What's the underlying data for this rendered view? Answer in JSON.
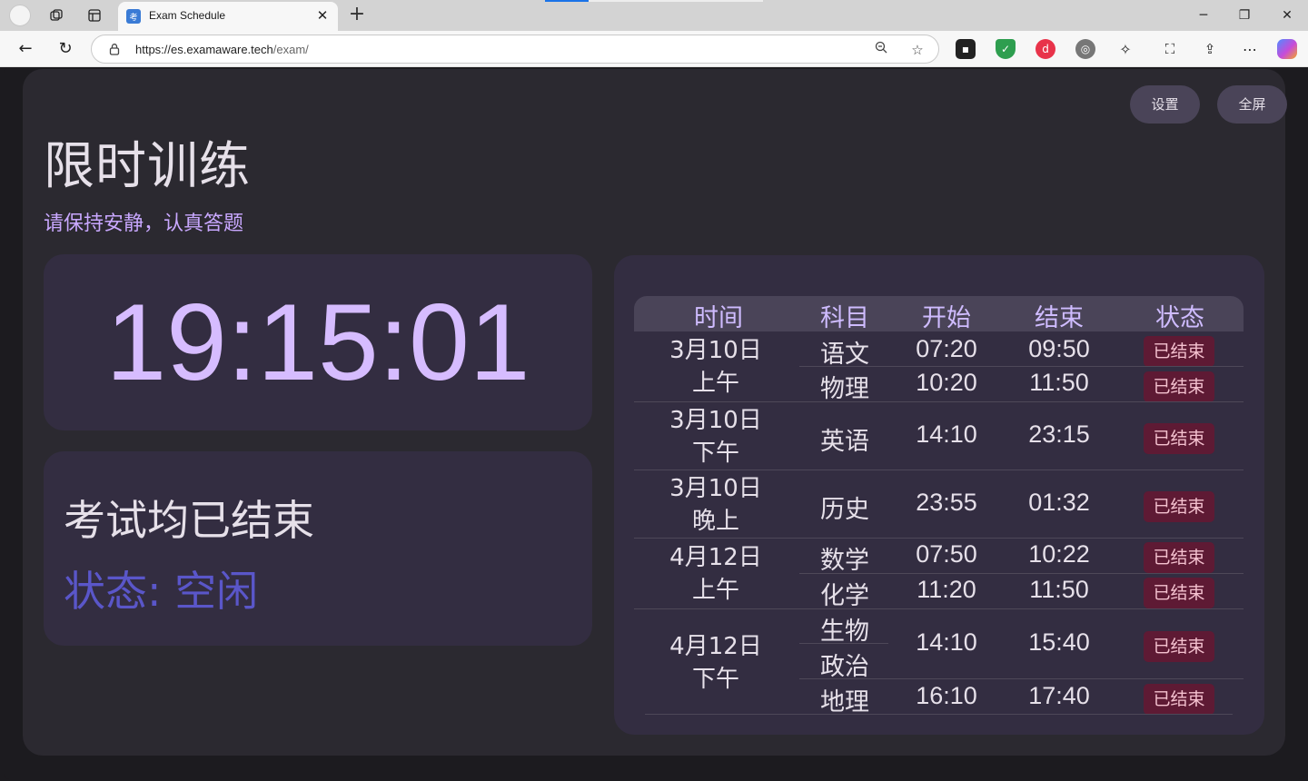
{
  "browser": {
    "tab_title": "Exam Schedule",
    "tab_favicon": "考",
    "url_host": "https://es.examaware.tech",
    "url_path": "/exam/"
  },
  "header": {
    "settings_label": "设置",
    "fullscreen_label": "全屏",
    "title": "限时训练",
    "subtitle": "请保持安静，认真答题"
  },
  "clock": {
    "time": "19:15:01"
  },
  "status": {
    "message": "考试均已结束",
    "state": "状态: 空闲"
  },
  "schedule": {
    "headers": [
      "时间",
      "科目",
      "开始",
      "结束",
      "状态"
    ],
    "groups": [
      {
        "date": "3月10日",
        "period": "上午"
      },
      {
        "date": "3月10日",
        "period": "下午"
      },
      {
        "date": "3月10日",
        "period": "晚上"
      },
      {
        "date": "4月12日",
        "period": "上午"
      },
      {
        "date": "4月12日",
        "period": "下午"
      }
    ],
    "rows": [
      {
        "subject": "语文",
        "start": "07:20",
        "end": "09:50",
        "status": "已结束"
      },
      {
        "subject": "物理",
        "start": "10:20",
        "end": "11:50",
        "status": "已结束"
      },
      {
        "subject": "英语",
        "start": "14:10",
        "end": "23:15",
        "status": "已结束"
      },
      {
        "subject": "历史",
        "start": "23:55",
        "end": "01:32",
        "status": "已结束"
      },
      {
        "subject": "数学",
        "start": "07:50",
        "end": "10:22",
        "status": "已结束"
      },
      {
        "subject": "化学",
        "start": "11:20",
        "end": "11:50",
        "status": "已结束"
      },
      {
        "subject": "生物",
        "subject2": "政治",
        "start": "14:10",
        "end": "15:40",
        "status": "已结束"
      },
      {
        "subject": "地理",
        "start": "16:10",
        "end": "17:40",
        "status": "已结束"
      }
    ]
  },
  "colors": {
    "accent": "#d6bcff",
    "badge_bg": "#5e1a34",
    "state_text": "#5a56c9"
  }
}
